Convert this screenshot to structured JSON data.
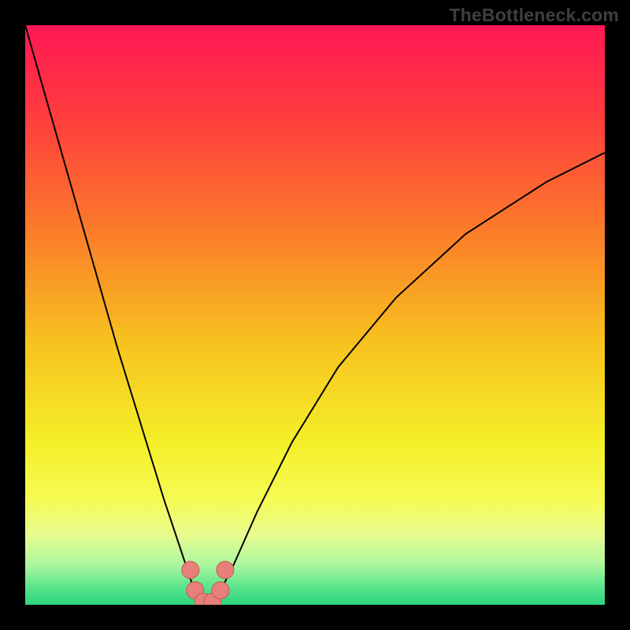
{
  "watermark": {
    "text": "TheBottleneck.com"
  },
  "chart_data": {
    "type": "line",
    "title": "",
    "xlabel": "",
    "ylabel": "",
    "xlim": [
      0,
      100
    ],
    "ylim": [
      0,
      100
    ],
    "grid": false,
    "legend": false,
    "background_gradient": {
      "stops": [
        {
          "offset": 0.0,
          "color": "#ff1754"
        },
        {
          "offset": 0.15,
          "color": "#ff3b3f"
        },
        {
          "offset": 0.35,
          "color": "#fb7a2a"
        },
        {
          "offset": 0.55,
          "color": "#f7c31f"
        },
        {
          "offset": 0.72,
          "color": "#f4ef28"
        },
        {
          "offset": 0.82,
          "color": "#f6fb55"
        },
        {
          "offset": 0.88,
          "color": "#e6fc8f"
        },
        {
          "offset": 0.93,
          "color": "#aef79e"
        },
        {
          "offset": 0.97,
          "color": "#59e58b"
        },
        {
          "offset": 1.0,
          "color": "#2bd47e"
        }
      ]
    },
    "series": [
      {
        "name": "bottleneck-curve",
        "color": "#000000",
        "x": [
          0,
          4,
          8,
          12,
          16,
          20,
          24,
          26,
          28,
          29,
          30,
          31,
          32,
          33,
          34,
          36,
          40,
          46,
          54,
          64,
          76,
          90,
          100
        ],
        "y": [
          100,
          86,
          72,
          58,
          44,
          31,
          18,
          12,
          6,
          3,
          1,
          0,
          0,
          1,
          3,
          7,
          16,
          28,
          41,
          53,
          64,
          73,
          78
        ]
      }
    ],
    "markers": {
      "name": "valley-points",
      "color": "#e77f7a",
      "stroke": "#c55a55",
      "radius_px": 11,
      "points": [
        {
          "x": 28.5,
          "y": 6
        },
        {
          "x": 29.3,
          "y": 2.5
        },
        {
          "x": 30.7,
          "y": 0.5
        },
        {
          "x": 32.3,
          "y": 0.5
        },
        {
          "x": 33.7,
          "y": 2.5
        },
        {
          "x": 34.5,
          "y": 6
        }
      ]
    }
  }
}
